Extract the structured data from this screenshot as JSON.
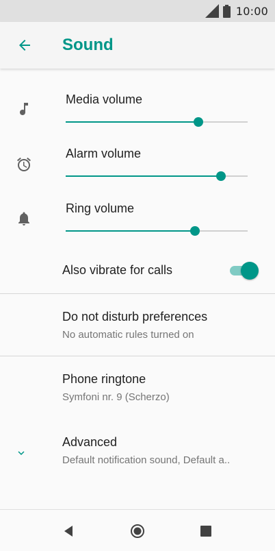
{
  "status_bar": {
    "time": "10:00"
  },
  "app_bar": {
    "title": "Sound"
  },
  "volumes": [
    {
      "label": "Media volume",
      "level": 0.73,
      "icon": "music-note-icon"
    },
    {
      "label": "Alarm volume",
      "level": 0.855,
      "icon": "alarm-clock-icon"
    },
    {
      "label": "Ring volume",
      "level": 0.71,
      "icon": "bell-icon"
    }
  ],
  "vibrate": {
    "label": "Also vibrate for calls",
    "enabled": true
  },
  "dnd": {
    "title": "Do not disturb preferences",
    "subtitle": "No automatic rules turned on"
  },
  "ringtone": {
    "title": "Phone ringtone",
    "subtitle": "Symfoni nr. 9 (Scherzo)"
  },
  "advanced": {
    "title": "Advanced",
    "subtitle": "Default notification sound, Default a.."
  },
  "colors": {
    "accent": "#009688",
    "accent_light": "#80cbc4",
    "icon_gray": "#616161"
  }
}
